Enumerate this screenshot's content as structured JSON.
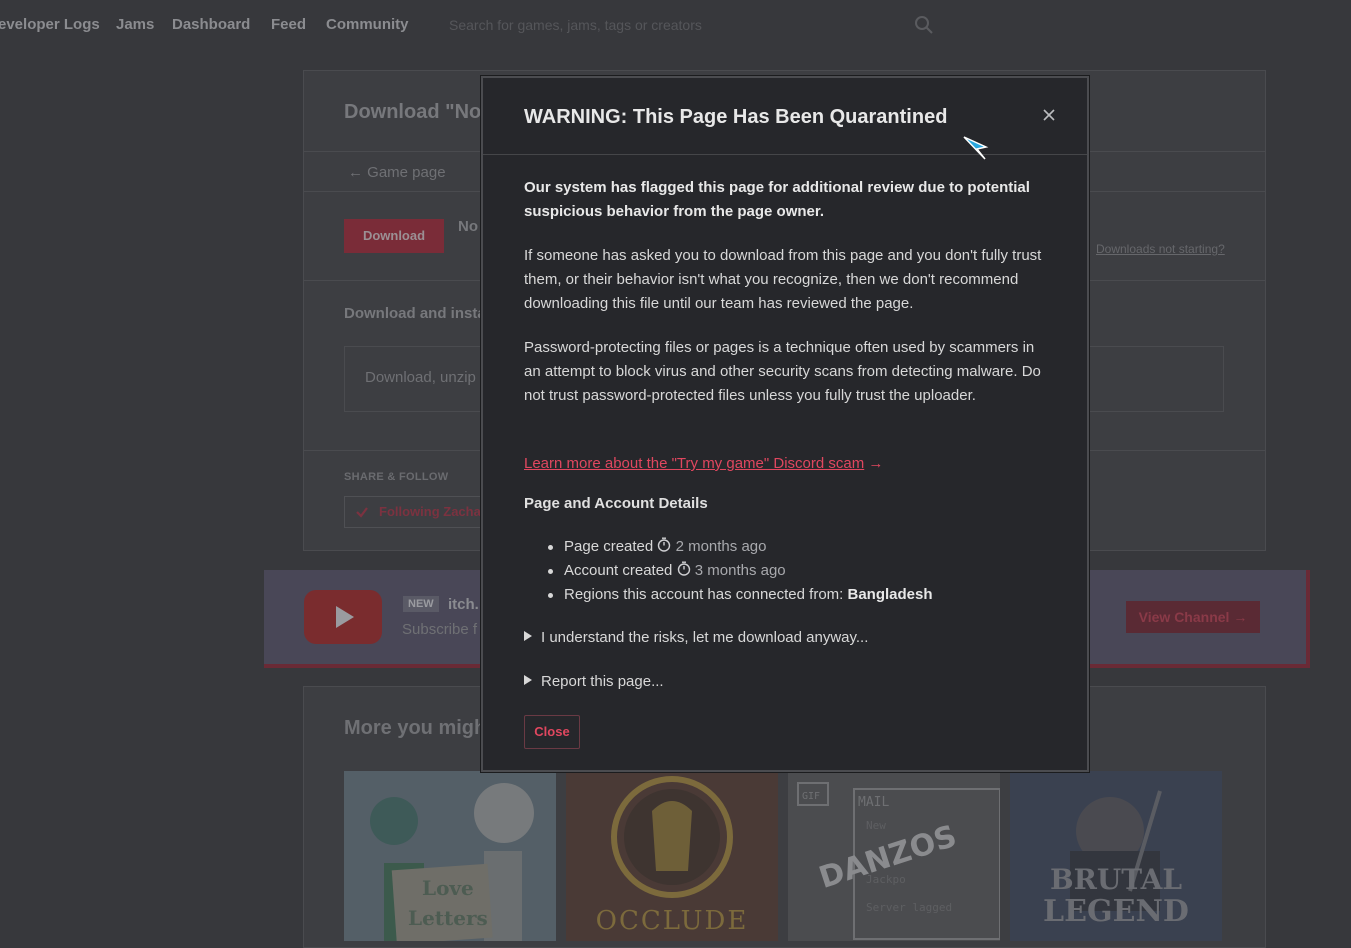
{
  "nav": {
    "links": [
      "eveloper Logs",
      "Jams",
      "Dashboard",
      "Feed",
      "Community"
    ],
    "search_placeholder": "Search for games, jams, tags or creators"
  },
  "background_page": {
    "title": "Download \"No",
    "back_link": "← Game page",
    "download_button": "Download",
    "file_name": "No",
    "downloads_not_starting": "Downloads not starting?",
    "install_heading": "Download and insta",
    "install_text": "Download, unzip",
    "share_heading": "SHARE & FOLLOW",
    "follow_button": "Following Zacha",
    "banner": {
      "new_badge": "NEW",
      "title": "itch.",
      "subtitle": "Subscribe f",
      "view_channel": "View Channel →"
    },
    "more_title": "More you migh",
    "thumbnails": [
      {
        "caption": "Love Letters",
        "color": "#5a6a78"
      },
      {
        "caption": "OCCLUDE",
        "color": "#4a3a34"
      },
      {
        "caption": "MAIL",
        "color": "#4e4f52"
      },
      {
        "caption": "BRUTAL LEGEND",
        "color": "#3a4250"
      }
    ]
  },
  "modal": {
    "title": "WARNING: This Page Has Been Quarantined",
    "intro": "Our system has flagged this page for additional review due to potential suspicious behavior from the page owner.",
    "paragraph1": "If someone has asked you to download from this page and you don't fully trust them, or their behavior isn't what you recognize, then we don't recommend downloading this file until our team has reviewed the page.",
    "paragraph2": "Password-protecting files or pages is a technique often used by scammers in an attempt to block virus and other security scans from detecting malware. Do not trust password-protected files unless you fully trust the uploader.",
    "learn_more_link": "Learn more about the \"Try my game\" Discord scam",
    "learn_more_arrow": "→",
    "details_heading": "Page and Account Details",
    "details": {
      "page_created_label": "Page created",
      "page_created_value": "2 months ago",
      "account_created_label": "Account created",
      "account_created_value": "3 months ago",
      "regions_label": "Regions this account has connected from:",
      "regions_value": "Bangladesh"
    },
    "understand_toggle": "I understand the risks, let me download anyway...",
    "report_toggle": "Report this page...",
    "close_button": "Close"
  },
  "colors": {
    "accent": "#e0475f",
    "modal_bg": "#26272b",
    "page_bg": "#37383c"
  }
}
